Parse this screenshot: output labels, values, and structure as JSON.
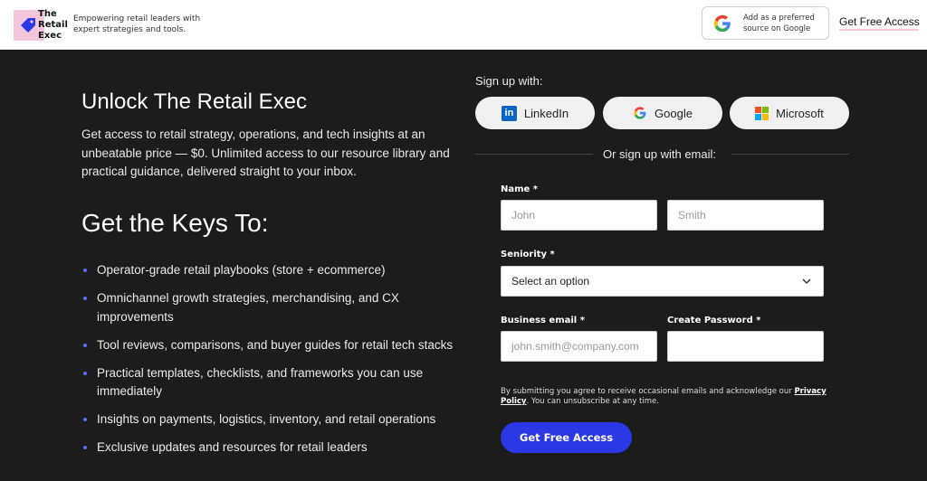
{
  "header": {
    "logo_lines": [
      "The",
      "Retail",
      "Exec"
    ],
    "tagline": "Empowering retail leaders with expert strategies and tools.",
    "google_pref": "Add as a preferred source on Google",
    "cta": "Get Free Access"
  },
  "left": {
    "title": "Unlock The Retail Exec",
    "intro": "Get access to retail strategy, operations, and tech insights at an unbeatable price — $0. Unlimited access to our resource library and practical guidance, delivered straight to your inbox.",
    "keys_title": "Get the Keys To:",
    "bullets": [
      "Operator-grade retail playbooks (store + ecommerce)",
      "Omnichannel growth strategies, merchandising, and CX improvements",
      "Tool reviews, comparisons, and buyer guides for retail tech stacks",
      "Practical templates, checklists, and frameworks you can use immediately",
      "Insights on payments, logistics, inventory, and retail operations",
      "Exclusive updates and resources for retail leaders"
    ]
  },
  "form": {
    "signup_with": "Sign up with:",
    "sso": {
      "linkedin": "LinkedIn",
      "google": "Google",
      "microsoft": "Microsoft"
    },
    "or_email": "Or sign up with email:",
    "name_label": "Name *",
    "first_placeholder": "John",
    "last_placeholder": "Smith",
    "seniority_label": "Seniority *",
    "seniority_value": "Select an option",
    "email_label": "Business email *",
    "email_placeholder": "john.smith@company.com",
    "password_label": "Create Password *",
    "consent_before": "By submitting you agree to receive occasional emails and acknowledge our ",
    "privacy_link": "Privacy Policy",
    "consent_after": ". You can unsubscribe at any time.",
    "submit": "Get Free Access"
  },
  "colors": {
    "accent_blue": "#2b38e6",
    "brand_pink": "#f4c6dc",
    "dark_bg": "#1c1c1c"
  }
}
